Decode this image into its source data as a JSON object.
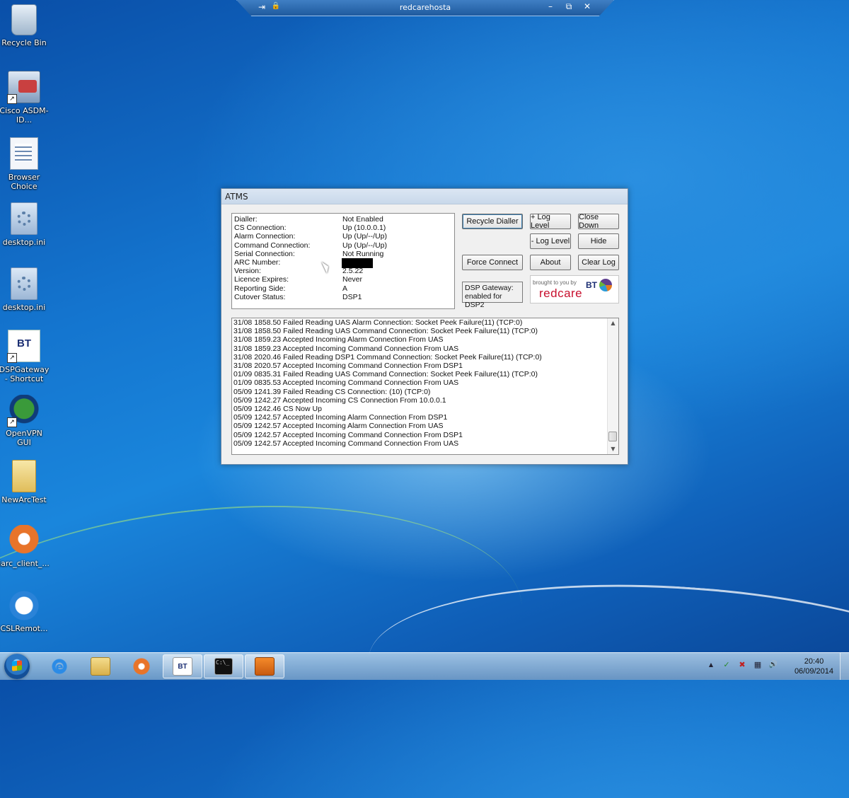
{
  "rdp": {
    "title": "redcarehosta",
    "pin_glyph": "⇥",
    "lock_glyph": "🔒",
    "minimize_glyph": "–",
    "restore_glyph": "⧉",
    "close_glyph": "✕"
  },
  "desktop_icons": [
    {
      "name": "recycle-bin",
      "label": "Recycle Bin",
      "icon": "recycle-bin-icon"
    },
    {
      "name": "cisco-asdm",
      "label": "Cisco ASDM-ID...",
      "icon": "cisco-asdm-icon"
    },
    {
      "name": "browser-choice",
      "label": "Browser Choice",
      "icon": "browser-choice-icon"
    },
    {
      "name": "desktop-ini-1",
      "label": "desktop.ini",
      "icon": "ini-file-icon"
    },
    {
      "name": "desktop-ini-2",
      "label": "desktop.ini",
      "icon": "ini-file-icon"
    },
    {
      "name": "dspgateway-shortcut",
      "label": "DSPGateway - Shortcut",
      "icon": "bt-icon"
    },
    {
      "name": "openvpn-gui",
      "label": "OpenVPN GUI",
      "icon": "openvpn-gui-icon"
    },
    {
      "name": "newarctest",
      "label": "NewArcTest",
      "icon": "folder-icon"
    },
    {
      "name": "iarc-client",
      "label": "iarc_client_...",
      "icon": "openvpn-client-icon"
    },
    {
      "name": "cslremote",
      "label": "CSLRemot...",
      "icon": "teamviewer-icon"
    }
  ],
  "atms": {
    "title": "ATMS",
    "status": [
      {
        "key": "Dialler:",
        "value": "Not Enabled"
      },
      {
        "key": "CS Connection:",
        "value": "Up (10.0.0.1)"
      },
      {
        "key": "Alarm Connection:",
        "value": "Up (Up/--/Up)"
      },
      {
        "key": "Command Connection:",
        "value": "Up (Up/--/Up)"
      },
      {
        "key": "Serial Connection:",
        "value": "Not Running"
      },
      {
        "key": "ARC Number:",
        "value": ""
      },
      {
        "key": "Version:",
        "value": "2.5.22"
      },
      {
        "key": "Licence Expires:",
        "value": "Never"
      },
      {
        "key": "Reporting Side:",
        "value": "A"
      },
      {
        "key": "Cutover Status:",
        "value": "DSP1"
      }
    ],
    "buttons": {
      "recycle_dialler": "Recycle Dialler",
      "plus_log_level": "+ Log Level",
      "close_down": "Close Down",
      "minus_log_level": "- Log Level",
      "hide": "Hide",
      "force_connect": "Force Connect",
      "about": "About",
      "clear_log": "Clear Log"
    },
    "dsp_gateway": {
      "line1": "DSP Gateway:",
      "line2": "enabled for DSP2"
    },
    "logo": {
      "tagline": "brought to you by",
      "brand": "redcare",
      "bt": "BT"
    },
    "log": [
      "31/08 1858.50 Failed Reading UAS Alarm Connection: Socket Peek Failure(11) (TCP:0)",
      "31/08 1858.50 Failed Reading UAS Command Connection: Socket Peek Failure(11) (TCP:0)",
      "31/08 1859.23 Accepted Incoming Alarm Connection From UAS",
      "31/08 1859.23 Accepted Incoming Command Connection From UAS",
      "31/08 2020.46 Failed Reading DSP1 Command Connection: Socket Peek Failure(11) (TCP:0)",
      "31/08 2020.57 Accepted Incoming Command Connection From DSP1",
      "01/09 0835.31 Failed Reading UAS Command Connection: Socket Peek Failure(11) (TCP:0)",
      "01/09 0835.53 Accepted Incoming Command Connection From UAS",
      "05/09 1241.39 Failed Reading CS Connection: (10) (TCP:0)",
      "05/09 1242.27 Accepted Incoming CS Connection From 10.0.0.1",
      "05/09 1242.46 CS Now Up",
      "05/09 1242.57 Accepted Incoming Alarm Connection From DSP1",
      "05/09 1242.57 Accepted Incoming Alarm Connection From UAS",
      "05/09 1242.57 Accepted Incoming Command Connection From DSP1",
      "05/09 1242.57 Accepted Incoming Command Connection From UAS"
    ]
  },
  "taskbar": {
    "buttons": [
      {
        "name": "internet-explorer",
        "icon": "internet-explorer-icon",
        "label": "e"
      },
      {
        "name": "windows-explorer",
        "icon": "folder-icon",
        "label": ""
      },
      {
        "name": "media-player",
        "icon": "media-player-icon",
        "label": ""
      },
      {
        "name": "bt-dspgateway",
        "icon": "bt-icon",
        "label": "BT"
      },
      {
        "name": "command-prompt",
        "icon": "command-prompt-icon",
        "label": "C:\\_"
      },
      {
        "name": "java-app",
        "icon": "java-icon",
        "label": ""
      }
    ],
    "tray": [
      "▲",
      "✓",
      "✖",
      "▦",
      "🔊"
    ],
    "time": "20:40",
    "date": "06/09/2014"
  }
}
